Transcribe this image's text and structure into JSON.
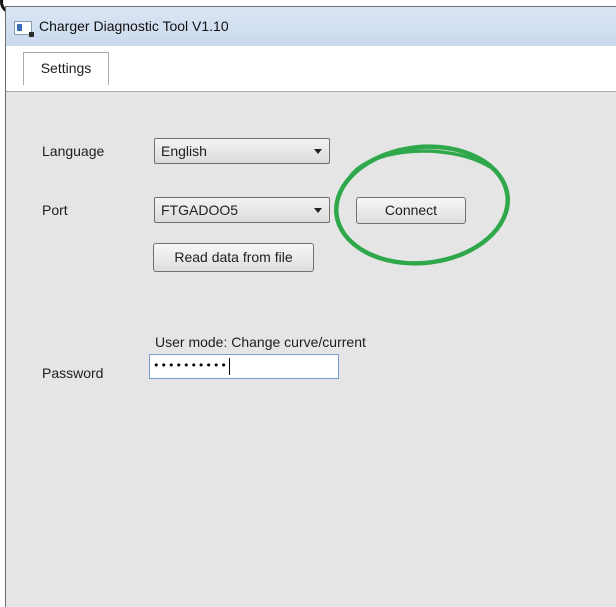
{
  "window": {
    "title": "Charger Diagnostic Tool V1.10"
  },
  "tabs": [
    {
      "label": "Settings",
      "selected": true
    }
  ],
  "settings": {
    "language_label": "Language",
    "language_value": "English",
    "port_label": "Port",
    "port_value": "FTGADOO5",
    "connect_label": "Connect",
    "read_file_label": "Read data from file",
    "user_mode_text": "User mode: Change curve/current",
    "password_label": "Password",
    "password_mask": "••••••••••"
  },
  "annotation": {
    "shape": "circle",
    "color": "#2ea84a"
  }
}
